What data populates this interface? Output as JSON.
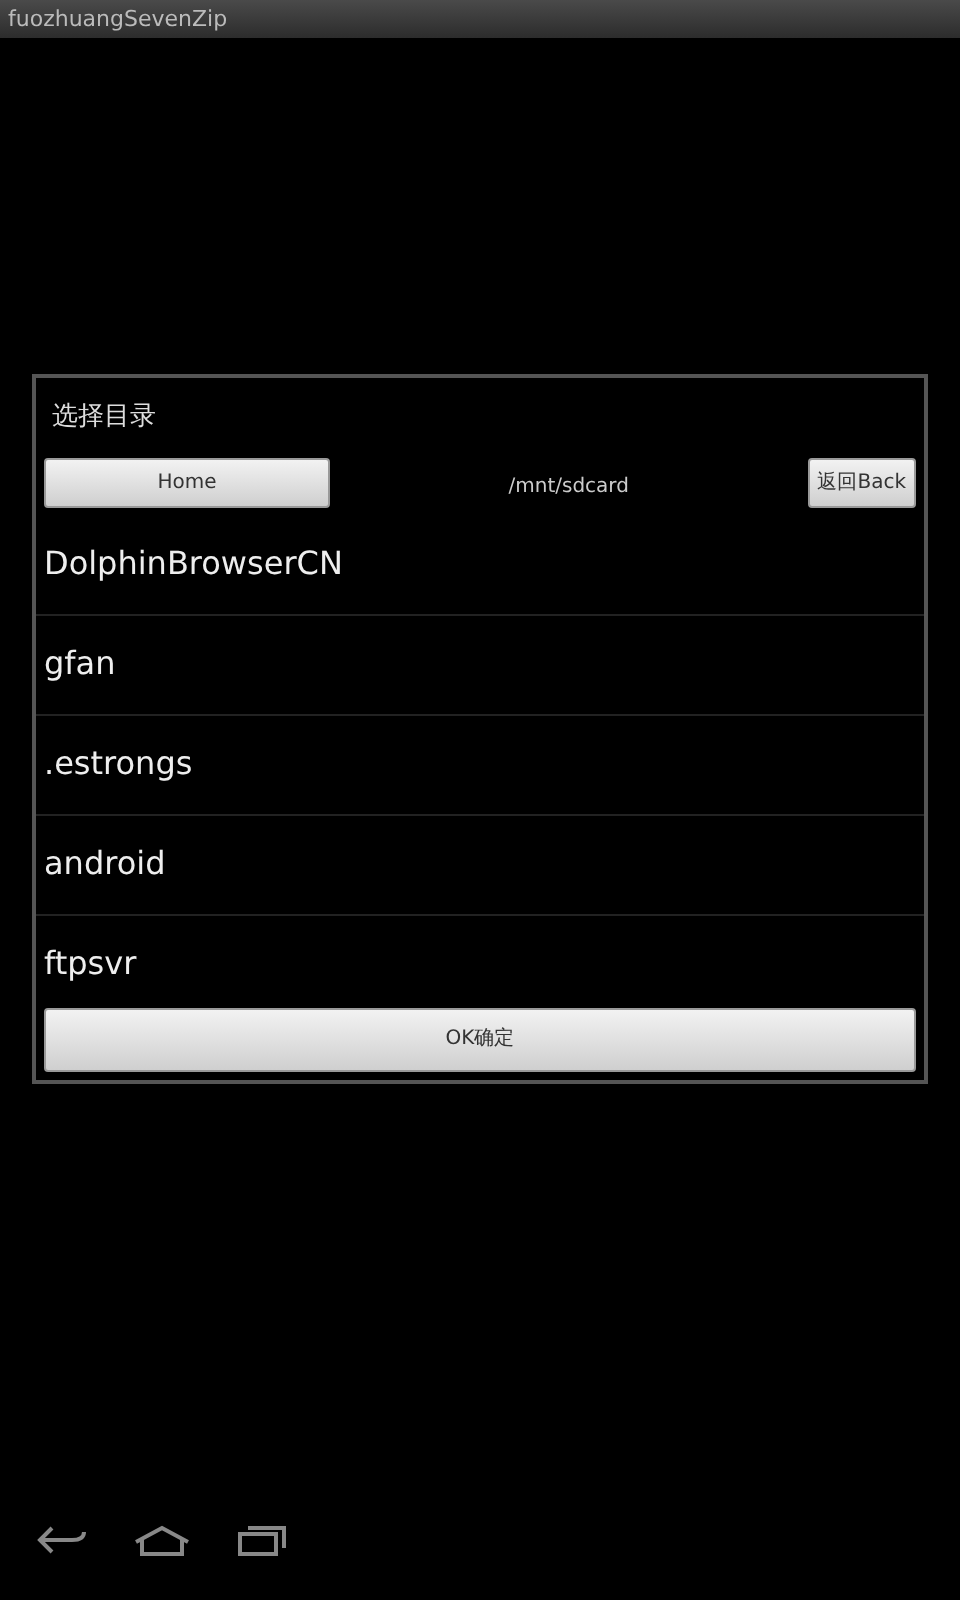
{
  "window": {
    "title": "fuozhuangSevenZip"
  },
  "dialog": {
    "title": "选择目录",
    "home_button": "Home",
    "path": "/mnt/sdcard",
    "back_button": "返回Back",
    "folders": [
      {
        "name": "DolphinBrowserCN"
      },
      {
        "name": "gfan"
      },
      {
        "name": ".estrongs"
      },
      {
        "name": "android"
      },
      {
        "name": "ftpsvr"
      }
    ],
    "ok_button": "OK确定"
  }
}
